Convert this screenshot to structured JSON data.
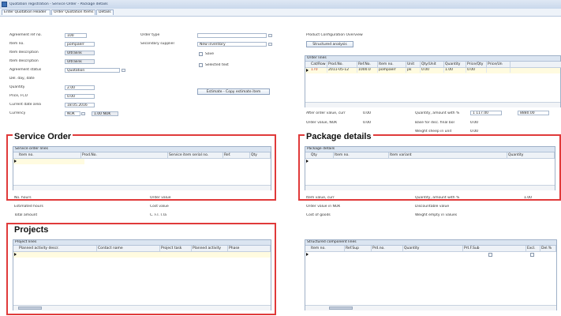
{
  "window": {
    "title": "Quotation registration - Service Order - Package details"
  },
  "tabs": [
    "Enter Quotation Header",
    "Order Quotation Items",
    "Details"
  ],
  "header_fields": [
    {
      "label": "Agreement ref no.",
      "value": "100"
    },
    {
      "label": "Item no.",
      "value": "pompaerr"
    },
    {
      "label": "Item description",
      "value": "Ultralink"
    },
    {
      "label": "Item description",
      "value": "Ultralink"
    },
    {
      "label": "Agreement status",
      "value": "Quotation"
    },
    {
      "label": "Del. day, date",
      "value": ""
    },
    {
      "label": "Quantity",
      "value": "2.00"
    },
    {
      "label": "Price, FCU",
      "value": "0.00"
    },
    {
      "label": "Current date area",
      "value": "18.05.2016"
    },
    {
      "label": "Currency",
      "value": "NOK"
    }
  ],
  "currency_rate": "1.00 NOK",
  "order_type": {
    "label": "Order type",
    "value": ""
  },
  "secondary_supplier": {
    "label": "Secondary supplier",
    "value": "New inventory"
  },
  "checkboxes": [
    "Save",
    "Selected text"
  ],
  "estimate_button": "Estimate - Copy estimate item",
  "product_config": {
    "label": "Product Configuration Overview",
    "button": "Structured analysis"
  },
  "order_lines": {
    "caption": "Order lines",
    "columns": [
      "Cat/Row",
      "Prod.No.",
      "Ref.No.",
      "Item no.",
      "Unit",
      "Qty/Unit",
      "Quantity",
      "Price/Qty",
      "Price/Un"
    ],
    "row": [
      "170",
      "2011-05-12",
      "1000.0",
      "pompaerr",
      "pk",
      "0.00",
      "1.00",
      "0.00",
      ""
    ]
  },
  "order_summary": [
    {
      "label": "After order value, curr",
      "value": "0.00"
    },
    {
      "label": "Quantity, amount with %",
      "value": "1 117.00"
    },
    {
      "label": "Order value, NOK",
      "value": "0.00"
    },
    {
      "label": "Base for disc. final bor",
      "value": "0.00"
    },
    {
      "label": "Weight sheep in unit",
      "value": "0.00"
    }
  ],
  "order_value_extra": "8880.00",
  "service_order": {
    "title": "Service Order",
    "caption": "Service order lines",
    "columns": [
      "Item no.",
      "Prod.No.",
      "Service item serial no.",
      "Ref.",
      "Qty"
    ],
    "fields": [
      {
        "label": "No. hours",
        "value": ""
      },
      {
        "label": "Order value",
        "value": ""
      },
      {
        "label": "Estimated hours",
        "value": ""
      },
      {
        "label": "Cost value",
        "value": ""
      },
      {
        "label": "Total amount",
        "value": ""
      },
      {
        "label": "C. F.I. I.Ta",
        "value": ""
      }
    ]
  },
  "package_details": {
    "title": "Package details",
    "caption": "Package details",
    "columns": [
      "Qty",
      "Item no.",
      "Item variant",
      "Quantity"
    ],
    "fields": [
      {
        "label": "Item value, curr",
        "value": ""
      },
      {
        "label": "Quantity, amount with %",
        "value": "1.00"
      },
      {
        "label": "Order value in NOK",
        "value": ""
      },
      {
        "label": "Discountable value",
        "value": ""
      },
      {
        "label": "Cost of goods",
        "value": ""
      },
      {
        "label": "Weight empty in values",
        "value": ""
      }
    ]
  },
  "projects": {
    "title": "Projects",
    "caption": "Project lines",
    "columns": [
      "Planned activity descr.",
      "Contact name",
      "Project task",
      "Planned activity",
      "Phase"
    ]
  },
  "structure_lines": {
    "caption": "Structured component lines",
    "columns": [
      "Item no.",
      "Ref.Sup",
      "Prd.no.",
      "Quantity",
      "Prt.F.Sub",
      "Excl.",
      "Del.%"
    ]
  }
}
